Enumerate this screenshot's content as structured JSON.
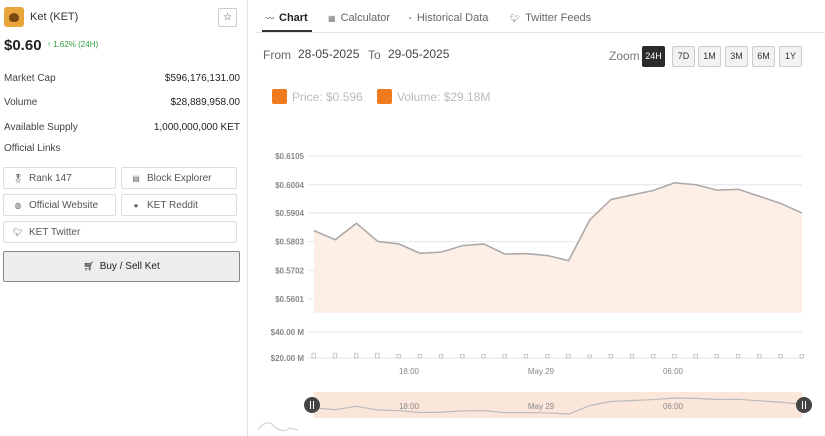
{
  "coin": {
    "name": "Ket (KET)",
    "price": "$0.60",
    "change": "↑ 1.62% (24H)",
    "star": "☆"
  },
  "stats": [
    {
      "label": "Market Cap",
      "value": "$596,176,131.00"
    },
    {
      "label": "Volume",
      "value": "$28,889,958.00"
    },
    {
      "label": "Available Supply",
      "value": "1,000,000,000 KET"
    }
  ],
  "links": {
    "heading": "Official Links",
    "rank": "Rank 147",
    "block_explorer": "Block Explorer",
    "website": "Official Website",
    "reddit": "KET Reddit",
    "twitter": "KET Twitter"
  },
  "buy_sell": "Buy / Sell Ket",
  "tabs": [
    {
      "label": "Chart",
      "icon": "chart-line-icon"
    },
    {
      "label": "Calculator",
      "icon": "calculator-icon"
    },
    {
      "label": "Historical Data",
      "icon": "history-icon"
    },
    {
      "label": "Twitter Feeds",
      "icon": "twitter-icon"
    }
  ],
  "range": {
    "from_label": "From",
    "from": "28-05-2025",
    "to_label": "To",
    "to": "29-05-2025"
  },
  "zoom": {
    "label": "Zoom",
    "options": [
      "24H",
      "7D",
      "1M",
      "3M",
      "6M",
      "1Y"
    ],
    "selected": "24H"
  },
  "legend": {
    "price": "Price: $0.596",
    "volume": "Volume: $29.18M",
    "color": "#f07b1e"
  },
  "chart_data": {
    "type": "area",
    "price_ticks": [
      "$0.6105",
      "$0.6004",
      "$0.5904",
      "$0.5803",
      "$0.5702",
      "$0.5601"
    ],
    "price_ylim": [
      0.5551,
      0.6155
    ],
    "volume_ticks": [
      "$40.00 M",
      "$20.00 M"
    ],
    "x_ticks": [
      "18:00",
      "May 29",
      "06:00"
    ],
    "price_series": {
      "values": [
        0.5842,
        0.581,
        0.5868,
        0.5804,
        0.5795,
        0.5762,
        0.5766,
        0.5789,
        0.5795,
        0.5759,
        0.5761,
        0.5754,
        0.5736,
        0.588,
        0.5952,
        0.5968,
        0.5984,
        0.6011,
        0.6004,
        0.5985,
        0.5988,
        0.5963,
        0.5938,
        0.5904
      ]
    },
    "volume_series": {
      "values": [
        22,
        22,
        22,
        22,
        21,
        21,
        21,
        21,
        21,
        21,
        21,
        21,
        21,
        20.5,
        21,
        21,
        21,
        21,
        21,
        21,
        21,
        21,
        21,
        21
      ]
    },
    "navigator_ticks": [
      "18:00",
      "May 29",
      "06:00"
    ],
    "fill_color": "#fdeee6",
    "line_color": "#aaaaaa"
  }
}
